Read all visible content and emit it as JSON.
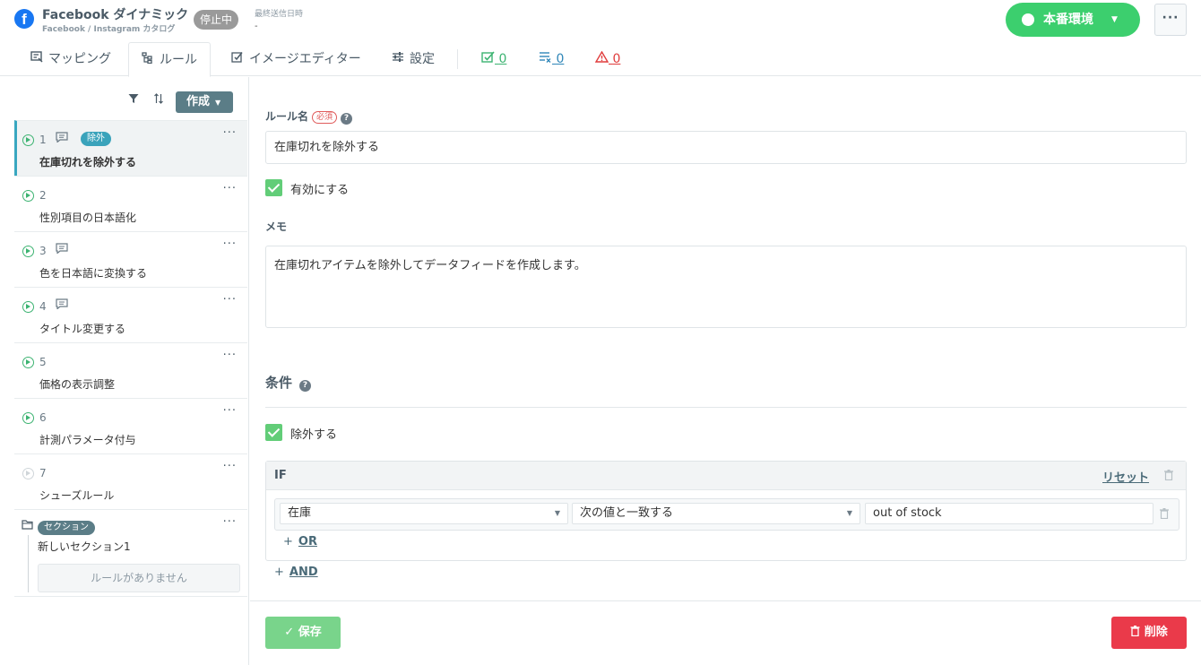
{
  "header": {
    "title": "Facebook ダイナミック",
    "subtitle": "Facebook / Instagram カタログ",
    "status": "停止中",
    "last_sent_label": "最終送信日時",
    "last_sent_value": "-",
    "env_label": "本番環境",
    "more_label": "···",
    "brand_color": "#1877f2",
    "env_color": "#3ccf6e"
  },
  "tabs": [
    {
      "label": "マッピング",
      "icon": "mapping-icon"
    },
    {
      "label": "ルール",
      "icon": "rule-tree-icon"
    },
    {
      "label": "イメージエディター",
      "icon": "image-edit-icon"
    },
    {
      "label": "設定",
      "icon": "sliders-icon"
    }
  ],
  "counters": [
    {
      "value": "0",
      "icon": "check-doc-icon",
      "color": "#3cb371"
    },
    {
      "value": "0",
      "icon": "list-x-icon",
      "color": "#2f86b8"
    },
    {
      "value": "0",
      "icon": "warning-icon",
      "color": "#e03c3c"
    }
  ],
  "sidebar": {
    "create_label": "作成",
    "rules": [
      {
        "num": "1",
        "name": "在庫切れを除外する",
        "badge": "除外",
        "memo": true,
        "enabled": true
      },
      {
        "num": "2",
        "name": "性別項目の日本語化",
        "badge": "",
        "memo": false,
        "enabled": true
      },
      {
        "num": "3",
        "name": "色を日本語に変換する",
        "badge": "",
        "memo": true,
        "enabled": true
      },
      {
        "num": "4",
        "name": "タイトル変更する",
        "badge": "",
        "memo": true,
        "enabled": true
      },
      {
        "num": "5",
        "name": "価格の表示調整",
        "badge": "",
        "memo": false,
        "enabled": true
      },
      {
        "num": "6",
        "name": "計測パラメータ付与",
        "badge": "",
        "memo": false,
        "enabled": true
      },
      {
        "num": "7",
        "name": "シューズルール",
        "badge": "",
        "memo": false,
        "enabled": false
      }
    ],
    "section": {
      "badge": "セクション",
      "name": "新しいセクション1",
      "empty_text": "ルールがありません"
    }
  },
  "form": {
    "rule_name_label": "ルール名",
    "required_label": "必須",
    "rule_name_value": "在庫切れを除外する",
    "enable_label": "有効にする",
    "memo_label": "メモ",
    "memo_value": "在庫切れアイテムを除外してデータフィードを作成します。",
    "conditions_title": "条件",
    "exclude_label": "除外する",
    "if_label": "IF",
    "reset_label": "リセット",
    "condition": {
      "field": "在庫",
      "operator": "次の値と一致する",
      "value": "out of stock"
    },
    "or_label": "OR",
    "and_label": "AND",
    "save_label": "保存",
    "delete_label": "削除"
  }
}
